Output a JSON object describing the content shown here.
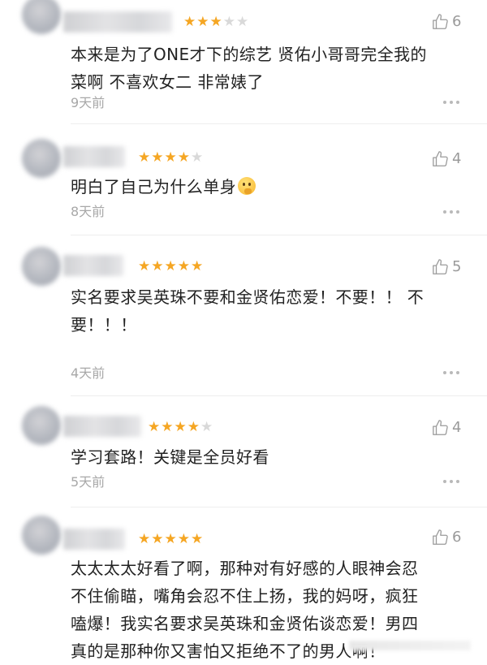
{
  "reviews": [
    {
      "username": "",
      "stars_filled": 3,
      "stars_total": 5,
      "likes": "6",
      "text": "本来是为了ONE才下的综艺 贤佑小哥哥完全我的\n菜啊 不喜欢女二 非常婊了",
      "time": "9天前"
    },
    {
      "username": "",
      "stars_filled": 4,
      "stars_total": 5,
      "likes": "4",
      "text": "明白了自己为什么单身",
      "emoji": "thinking-face-emoji",
      "time": "8天前"
    },
    {
      "username": "",
      "stars_filled": 5,
      "stars_total": 5,
      "likes": "5",
      "text": "实名要求吴英珠不要和金贤佑恋爱！不要！！ 不\n要！！！",
      "time": "4天前"
    },
    {
      "username": "",
      "stars_filled": 4,
      "stars_total": 5,
      "likes": "4",
      "text": "学习套路！关键是全员好看",
      "time": "5天前"
    },
    {
      "username": "",
      "stars_filled": 5,
      "stars_total": 5,
      "likes": "6",
      "text": "太太太太好看了啊，那种对有好感的人眼神会忍\n不住偷瞄，嘴角会忍不住上扬，我的妈呀，疯狂\n嗑爆！我实名要求吴英珠和金贤佑谈恋爱！男四\n真的是那种你又害怕又拒绝不了的男人啊！",
      "time": ""
    }
  ],
  "colors": {
    "star_on": "#f5a623",
    "star_off": "#d9d9d9",
    "meta_gray": "#a8a8a8"
  },
  "icons": {
    "like": "thumbs-up-outline-icon",
    "more": "more-dots-icon"
  }
}
